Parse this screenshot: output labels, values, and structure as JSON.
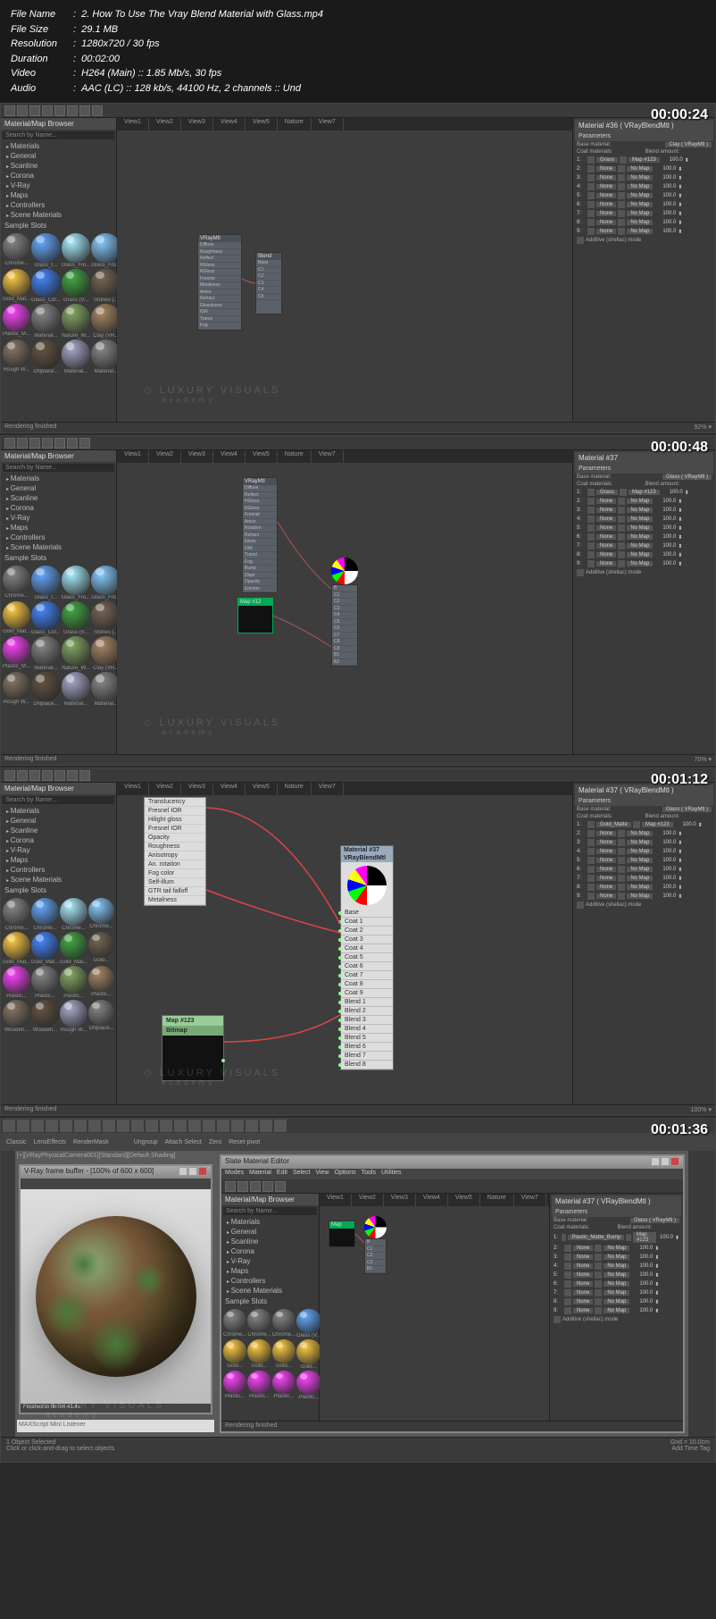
{
  "meta": {
    "filename_label": "File Name",
    "filename": "2. How To Use The Vray Blend Material with Glass.mp4",
    "filesize_label": "File Size",
    "filesize": "29.1 MB",
    "resolution_label": "Resolution",
    "resolution": "1280x720 / 30 fps",
    "duration_label": "Duration",
    "duration": "00:02:00",
    "video_label": "Video",
    "video": "H264 (Main) :: 1.85 Mb/s, 30 fps",
    "audio_label": "Audio",
    "audio": "AAC (LC) :: 128 kb/s, 44100 Hz, 2 channels :: Und"
  },
  "timestamps": [
    "00:00:24",
    "00:00:48",
    "00:01:12",
    "00:01:36"
  ],
  "watermark": {
    "line1": "LUXURY VISUALS",
    "line2": "academy"
  },
  "browser": {
    "title": "Material/Map Browser",
    "search": "Search by Name...",
    "categories": [
      "Materials",
      "General",
      "Scanline",
      "Corona",
      "V-Ray",
      "Maps",
      "Controllers",
      "Scene Materials"
    ],
    "sample_label": "Sample Slots",
    "materials_s1": [
      "Chrome...",
      "Glass_t...",
      "Glass_Fro...",
      "Glass_Fro...",
      "Gold_Mat...",
      "Glass_Col...",
      "Grass (V...",
      "Stones (...",
      "Plastic_M...",
      "Material...",
      "Nature_W...",
      "Clay (VR...",
      "Rough W...",
      "DNplace...",
      "Material...",
      "Material..."
    ],
    "materials_s3": [
      "Chrome...",
      "Chrome...",
      "Chrome...",
      "Chrome...",
      "Gold_Mat...",
      "Gold_Mat...",
      "Gold_Mat...",
      "Gold...",
      "Plastic...",
      "Plastic...",
      "Plastic...",
      "Plastic...",
      "Wooden...",
      "Wooden...",
      "Rough W...",
      "DNplace..."
    ],
    "materials_s4": [
      "Chrome...",
      "Chrome...",
      "Chrome...",
      "Glass (V...",
      "Gold...",
      "Gold...",
      "Gold...",
      "Gold...",
      "Plastic...",
      "Plastic...",
      "Plastic...",
      "Plastic..."
    ]
  },
  "views": [
    "View1",
    "View2",
    "View3",
    "View4",
    "View5",
    "Nature",
    "View7"
  ],
  "params": {
    "title_s1": "Material #36 ( VRayBlendMtl )",
    "title_s2": "Material #37",
    "title_s3": "Material #37 ( VRayBlendMtl )",
    "section": "Parameters",
    "base_label": "Base material:",
    "base_btn_s1": "Clay ( VRayMtl )",
    "base_btn_s2": "Glass ( VRayMtl )",
    "coat_label": "Coat materials:",
    "blend_label": "Blend amount:",
    "additive": "Additive (shellac) mode",
    "rows_s1": [
      {
        "n": "1:",
        "name": "Grass",
        "map": "Map #123",
        "val": "100.0"
      },
      {
        "n": "2:",
        "name": "None",
        "map": "No Map",
        "val": "100.0"
      },
      {
        "n": "3:",
        "name": "None",
        "map": "No Map",
        "val": "100.0"
      },
      {
        "n": "4:",
        "name": "None",
        "map": "No Map",
        "val": "100.0"
      },
      {
        "n": "5:",
        "name": "None",
        "map": "No Map",
        "val": "100.0"
      },
      {
        "n": "6:",
        "name": "None",
        "map": "No Map",
        "val": "100.0"
      },
      {
        "n": "7:",
        "name": "None",
        "map": "No Map",
        "val": "100.0"
      },
      {
        "n": "8:",
        "name": "None",
        "map": "No Map",
        "val": "100.0"
      },
      {
        "n": "9:",
        "name": "None",
        "map": "No Map",
        "val": "100.0"
      }
    ],
    "rows_s3": [
      {
        "n": "1:",
        "name": "Gold_Matte",
        "map": "Map #123",
        "val": "100.0"
      },
      {
        "n": "2:",
        "name": "None",
        "map": "No Map",
        "val": "100.0"
      },
      {
        "n": "3:",
        "name": "None",
        "map": "No Map",
        "val": "100.0"
      },
      {
        "n": "4:",
        "name": "None",
        "map": "No Map",
        "val": "100.0"
      },
      {
        "n": "5:",
        "name": "None",
        "map": "No Map",
        "val": "100.0"
      },
      {
        "n": "6:",
        "name": "None",
        "map": "No Map",
        "val": "100.0"
      },
      {
        "n": "7:",
        "name": "None",
        "map": "No Map",
        "val": "100.0"
      },
      {
        "n": "8:",
        "name": "None",
        "map": "No Map",
        "val": "100.0"
      },
      {
        "n": "9:",
        "name": "None",
        "map": "No Map",
        "val": "100.0"
      }
    ],
    "rows_s4": [
      {
        "n": "1:",
        "name": "Plastic_Matte_Bump",
        "map": "Map #123",
        "val": "100.0"
      },
      {
        "n": "2:",
        "name": "None",
        "map": "No Map",
        "val": "100.0"
      },
      {
        "n": "3:",
        "name": "None",
        "map": "No Map",
        "val": "100.0"
      },
      {
        "n": "4:",
        "name": "None",
        "map": "No Map",
        "val": "100.0"
      },
      {
        "n": "5:",
        "name": "None",
        "map": "No Map",
        "val": "100.0"
      },
      {
        "n": "6:",
        "name": "None",
        "map": "No Map",
        "val": "100.0"
      },
      {
        "n": "7:",
        "name": "None",
        "map": "No Map",
        "val": "100.0"
      },
      {
        "n": "8:",
        "name": "None",
        "map": "No Map",
        "val": "100.0"
      },
      {
        "n": "9:",
        "name": "None",
        "map": "No Map",
        "val": "100.0"
      }
    ]
  },
  "status": {
    "rendering": "Rendering finished",
    "zoom_s1": "92% ▾",
    "zoom_s2": "70% ▾",
    "zoom_s3": "100% ▾"
  },
  "node_props": [
    "Translucency",
    "Fresnel IOR",
    "Hilight gloss",
    "Fresnel IOR",
    "Opacity",
    "Roughness",
    "Anisotropy",
    "An. rotation",
    "Fog color",
    "Self-illum",
    "GTR tail falloff",
    "Metalness"
  ],
  "blend_node": {
    "title1": "Material #37",
    "title2": "VRayBlendMtl",
    "slots": [
      "Base",
      "Coat 1",
      "Coat 2",
      "Coat 3",
      "Coat 4",
      "Coat 5",
      "Coat 6",
      "Coat 7",
      "Coat 8",
      "Coat 9",
      "Blend 1",
      "Blend 2",
      "Blend 3",
      "Blend 4",
      "Blend 5",
      "Blend 6",
      "Blend 7",
      "Blend 8"
    ]
  },
  "bitmap_node": {
    "title1": "Map #123",
    "title2": "Bitmap"
  },
  "sec4": {
    "menu": [
      "Classic",
      "LensEffects",
      "RenderMask"
    ],
    "ribbon": [
      "Ungroup",
      "Attach Select",
      "Zero",
      "Reset pivot"
    ],
    "render_title": "V-Ray frame buffer - [100% of 600 x 600]",
    "camera_label": "[+][VRayPhysicalCamera001][Standard][Default Shading]",
    "slate_title": "Slate Material Editor",
    "slate_menu": [
      "Modes",
      "Material",
      "Edit",
      "Select",
      "View",
      "Options",
      "Tools",
      "Utilities"
    ],
    "status1": "1 Object Selected",
    "status2": "Click or click-and-drag to select objects",
    "grid": "Grid = 10.0cm",
    "addtime": "Add Time Tag",
    "script": "MAXScript Mini Listener",
    "finished": "Finished in 0h 0m 41.4s"
  },
  "mat_colors": [
    "#888",
    "#6af",
    "#aef",
    "#8cf",
    "#fc4",
    "#48f",
    "#4a4",
    "#765",
    "#f4f",
    "#888",
    "#8a6",
    "#a86",
    "#876",
    "#654",
    "#aac",
    "#888"
  ],
  "mat_colors_s4": [
    "#888",
    "#888",
    "#888",
    "#6af",
    "#fc4",
    "#fc4",
    "#fc4",
    "#fc4",
    "#f4f",
    "#f4f",
    "#f4f",
    "#f4f"
  ]
}
